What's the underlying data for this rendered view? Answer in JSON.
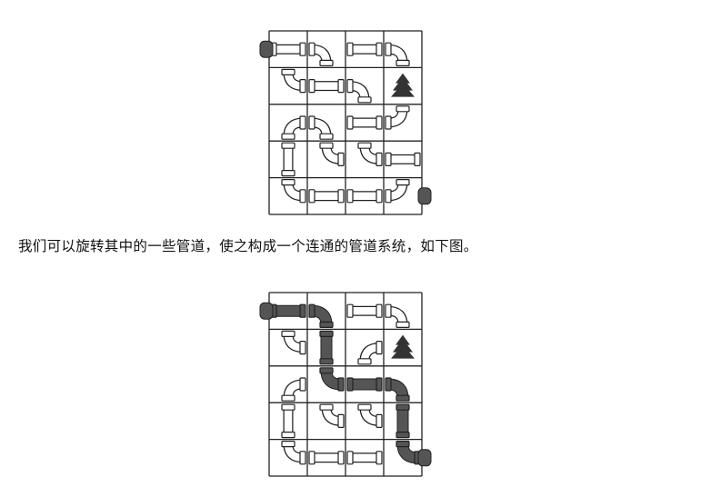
{
  "caption": "我们可以旋转其中的一些管道，使之构成一个连通的管道系统，如下图。",
  "colors": {
    "grid": "#222222",
    "pipe_outline": "#222222",
    "pipe_fill": "#ffffff",
    "connected_pipe": "#555555",
    "tree": "#333333"
  },
  "puzzles": [
    {
      "name": "initial",
      "columns": 4,
      "rows": 5,
      "tiles": [
        [
          "straight-h",
          "elbow-left-down",
          "straight-h",
          "elbow-left-down"
        ],
        [
          "elbow-top-right",
          "straight-h",
          "elbow-left-down",
          "tree"
        ],
        [
          "elbow-right-down",
          "elbow-left-down",
          "straight-h",
          "elbow-top-left"
        ],
        [
          "straight-v",
          "elbow-top-right",
          "elbow-top-right",
          "straight-h"
        ],
        [
          "elbow-top-right",
          "straight-h",
          "straight-h",
          "elbow-left-top"
        ]
      ],
      "connected": [],
      "start": "left of row 1 column 1",
      "end": "right of row 5 column 4"
    },
    {
      "name": "solved",
      "columns": 4,
      "rows": 5,
      "tiles": [
        [
          "straight-h",
          "elbow-left-down",
          "straight-h",
          "elbow-left-down"
        ],
        [
          "elbow-top-right",
          "straight-v",
          "elbow-right-down",
          "tree"
        ],
        [
          "elbow-right-down",
          "elbow-top-right",
          "straight-h",
          "elbow-left-down"
        ],
        [
          "straight-v",
          "elbow-top-right",
          "elbow-top-right",
          "straight-v"
        ],
        [
          "elbow-top-right",
          "straight-h",
          "straight-h",
          "elbow-top-right"
        ]
      ],
      "connected": [
        "0,0",
        "1,0",
        "1,1",
        "1,2",
        "2,2",
        "3,2",
        "3,3",
        "3,4"
      ],
      "start": "left of row 1 column 1",
      "end": "right of row 5 column 4"
    }
  ]
}
